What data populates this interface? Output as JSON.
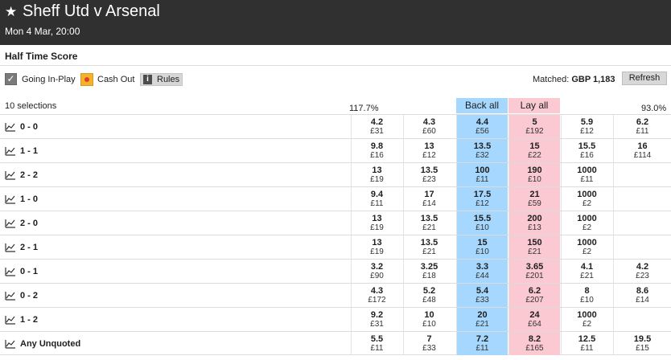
{
  "event": {
    "title": "Sheff Utd v Arsenal",
    "datetime": "Mon 4 Mar, 20:00"
  },
  "market": {
    "name": "Half Time Score"
  },
  "toolbar": {
    "going_inplay": "Going In-Play",
    "cash_out": "Cash Out",
    "rules": "Rules",
    "matched_label": "Matched:",
    "matched_value": "GBP 1,183",
    "refresh": "Refresh"
  },
  "selections_label": "10 selections",
  "back_pct": "117.7%",
  "lay_pct": "93.0%",
  "back_all": "Back all",
  "lay_all": "Lay all",
  "colors": {
    "back": "#a6d8ff",
    "lay": "#fac9d1",
    "header_bg": "#303030"
  },
  "runners": [
    {
      "name": "0 - 0",
      "prices": [
        {
          "odds": "4.2",
          "stake": "£31"
        },
        {
          "odds": "4.3",
          "stake": "£60"
        },
        {
          "odds": "4.4",
          "stake": "£56"
        },
        {
          "odds": "5",
          "stake": "£192"
        },
        {
          "odds": "5.9",
          "stake": "£12"
        },
        {
          "odds": "6.2",
          "stake": "£11"
        }
      ]
    },
    {
      "name": "1 - 1",
      "prices": [
        {
          "odds": "9.8",
          "stake": "£16"
        },
        {
          "odds": "13",
          "stake": "£12"
        },
        {
          "odds": "13.5",
          "stake": "£32"
        },
        {
          "odds": "15",
          "stake": "£22"
        },
        {
          "odds": "15.5",
          "stake": "£16"
        },
        {
          "odds": "16",
          "stake": "£114"
        }
      ]
    },
    {
      "name": "2 - 2",
      "prices": [
        {
          "odds": "13",
          "stake": "£19"
        },
        {
          "odds": "13.5",
          "stake": "£23"
        },
        {
          "odds": "100",
          "stake": "£11"
        },
        {
          "odds": "190",
          "stake": "£10"
        },
        {
          "odds": "1000",
          "stake": "£11"
        },
        {
          "odds": "",
          "stake": ""
        }
      ]
    },
    {
      "name": "1 - 0",
      "prices": [
        {
          "odds": "9.4",
          "stake": "£11"
        },
        {
          "odds": "17",
          "stake": "£14"
        },
        {
          "odds": "17.5",
          "stake": "£12"
        },
        {
          "odds": "21",
          "stake": "£59"
        },
        {
          "odds": "1000",
          "stake": "£2"
        },
        {
          "odds": "",
          "stake": ""
        }
      ]
    },
    {
      "name": "2 - 0",
      "prices": [
        {
          "odds": "13",
          "stake": "£19"
        },
        {
          "odds": "13.5",
          "stake": "£21"
        },
        {
          "odds": "15.5",
          "stake": "£10"
        },
        {
          "odds": "200",
          "stake": "£13"
        },
        {
          "odds": "1000",
          "stake": "£2"
        },
        {
          "odds": "",
          "stake": ""
        }
      ]
    },
    {
      "name": "2 - 1",
      "prices": [
        {
          "odds": "13",
          "stake": "£19"
        },
        {
          "odds": "13.5",
          "stake": "£21"
        },
        {
          "odds": "15",
          "stake": "£10"
        },
        {
          "odds": "150",
          "stake": "£21"
        },
        {
          "odds": "1000",
          "stake": "£2"
        },
        {
          "odds": "",
          "stake": ""
        }
      ]
    },
    {
      "name": "0 - 1",
      "prices": [
        {
          "odds": "3.2",
          "stake": "£90"
        },
        {
          "odds": "3.25",
          "stake": "£18"
        },
        {
          "odds": "3.3",
          "stake": "£44"
        },
        {
          "odds": "3.65",
          "stake": "£201"
        },
        {
          "odds": "4.1",
          "stake": "£21"
        },
        {
          "odds": "4.2",
          "stake": "£23"
        }
      ]
    },
    {
      "name": "0 - 2",
      "prices": [
        {
          "odds": "4.3",
          "stake": "£172"
        },
        {
          "odds": "5.2",
          "stake": "£48"
        },
        {
          "odds": "5.4",
          "stake": "£33"
        },
        {
          "odds": "6.2",
          "stake": "£207"
        },
        {
          "odds": "8",
          "stake": "£10"
        },
        {
          "odds": "8.6",
          "stake": "£14"
        }
      ]
    },
    {
      "name": "1 - 2",
      "prices": [
        {
          "odds": "9.2",
          "stake": "£31"
        },
        {
          "odds": "10",
          "stake": "£10"
        },
        {
          "odds": "20",
          "stake": "£21"
        },
        {
          "odds": "24",
          "stake": "£64"
        },
        {
          "odds": "1000",
          "stake": "£2"
        },
        {
          "odds": "",
          "stake": ""
        }
      ]
    },
    {
      "name": "Any Unquoted",
      "prices": [
        {
          "odds": "5.5",
          "stake": "£11"
        },
        {
          "odds": "7",
          "stake": "£33"
        },
        {
          "odds": "7.2",
          "stake": "£11"
        },
        {
          "odds": "8.2",
          "stake": "£165"
        },
        {
          "odds": "12.5",
          "stake": "£11"
        },
        {
          "odds": "19.5",
          "stake": "£15"
        }
      ]
    }
  ]
}
